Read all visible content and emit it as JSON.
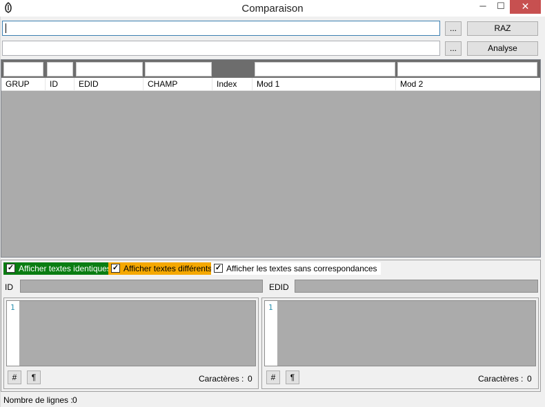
{
  "window": {
    "title": "Comparaison",
    "minimize_glyph": "─",
    "maximize_glyph": "☐",
    "close_glyph": "✕",
    "icon": "app-logo-icon"
  },
  "toolbar": {
    "input1_value": "",
    "input2_value": "",
    "browse1_label": "...",
    "browse2_label": "...",
    "raz_label": "RAZ",
    "analyse_label": "Analyse"
  },
  "grid": {
    "columns": [
      "GRUP",
      "ID",
      "EDID",
      "CHAMP",
      "Index",
      "Mod 1",
      "Mod 2"
    ],
    "rows": []
  },
  "filters": {
    "identiques": {
      "label": "Afficher textes identiques",
      "checked": true,
      "color": "#0a7d12"
    },
    "differents": {
      "label": "Afficher textes différents",
      "checked": true,
      "color": "#f5a800"
    },
    "sans_corr": {
      "label": "Afficher les textes sans correspondances",
      "checked": true,
      "color": "#ffffff"
    },
    "check_glyph": "✓"
  },
  "details": {
    "id_label": "ID",
    "id_value": "",
    "edid_label": "EDID",
    "edid_value": ""
  },
  "left_editor": {
    "line_number": "1",
    "hash_button": "#",
    "pilcrow_button": "¶",
    "chars_label": "Caractères :",
    "chars_value": "0"
  },
  "right_editor": {
    "line_number": "1",
    "hash_button": "#",
    "pilcrow_button": "¶",
    "chars_label": "Caractères :",
    "chars_value": "0"
  },
  "status": {
    "lines_label": "Nombre de lignes :",
    "lines_value": "0"
  }
}
